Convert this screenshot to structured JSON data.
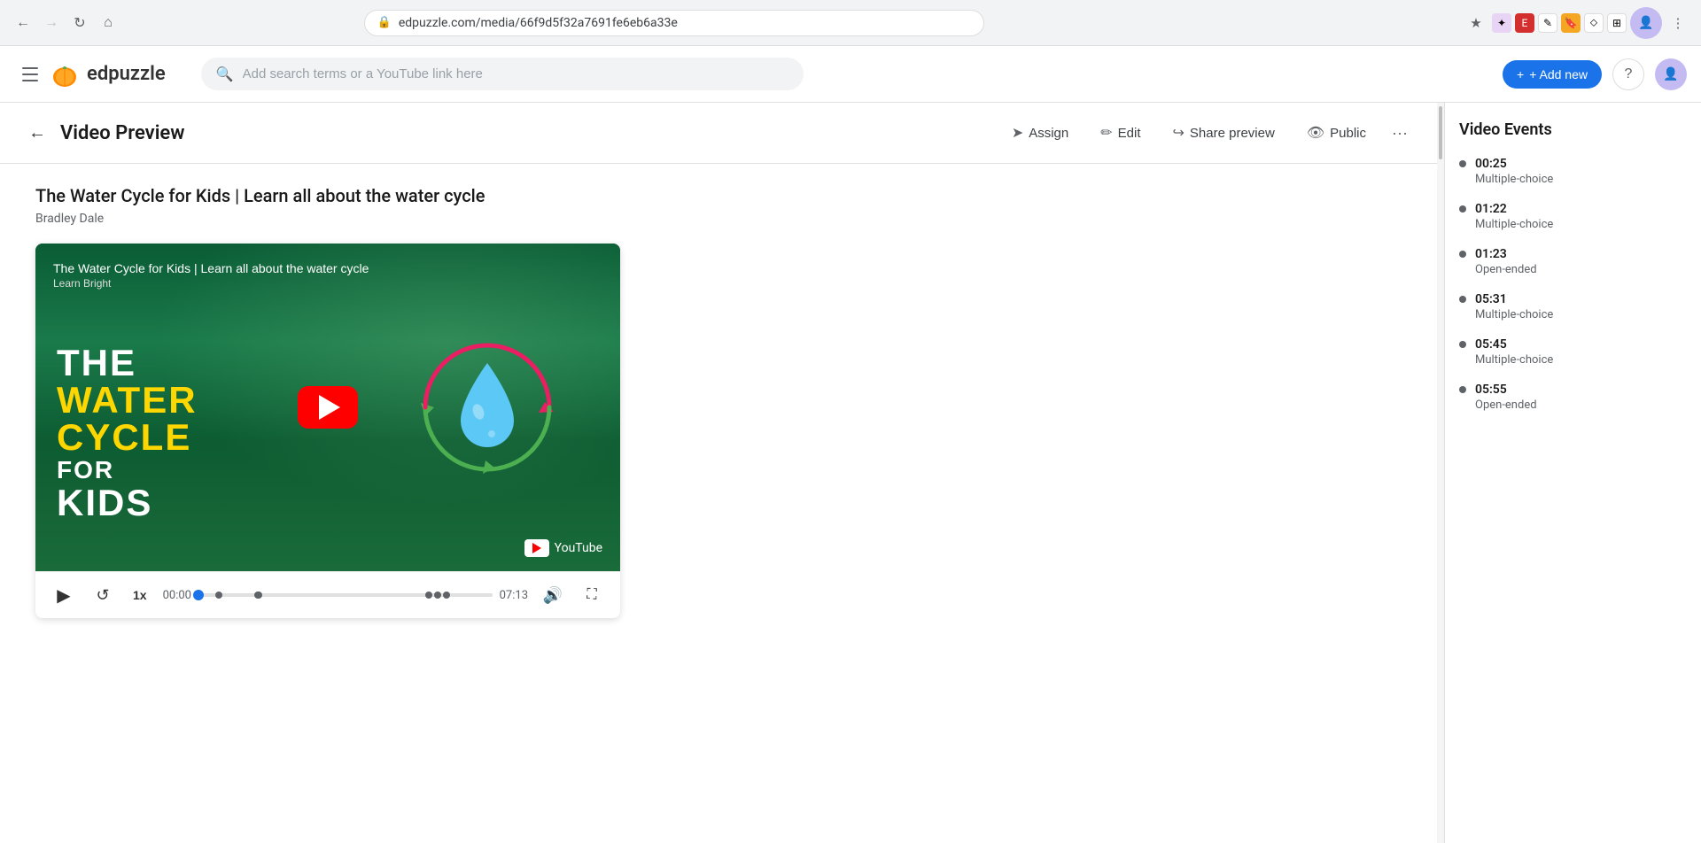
{
  "browser": {
    "url": "edpuzzle.com/media/66f9d5f32a7691fe6eb6a33e",
    "nav": {
      "back_disabled": false,
      "forward_disabled": true,
      "reload_label": "⟳",
      "home_label": "⌂"
    }
  },
  "app": {
    "logo_text": "edpuzzle",
    "search_placeholder": "Add search terms or a YouTube link here",
    "add_new_label": "+ Add new",
    "help_label": "?"
  },
  "toolbar": {
    "back_label": "←",
    "page_title": "Video Preview",
    "assign_label": "Assign",
    "edit_label": "Edit",
    "share_preview_label": "Share preview",
    "public_label": "Public",
    "more_label": "···"
  },
  "video": {
    "title": "The Water Cycle for Kids | Learn all about the water cycle",
    "author": "Bradley Dale",
    "thumbnail_line1": "The Water Cycle for Kids | Learn all about the water cycle",
    "thumbnail_channel": "Learn Bright",
    "text_the": "THE",
    "text_water": "WATER",
    "text_cycle": "CYCLE",
    "text_for": "FOR",
    "text_kids": "KIDS",
    "youtube_label": "YouTube",
    "current_time": "00:00",
    "duration": "07:13",
    "speed": "1x"
  },
  "sidebar": {
    "title": "Video Events",
    "events": [
      {
        "time": "00:25",
        "type": "Multiple-choice"
      },
      {
        "time": "01:22",
        "type": "Multiple-choice"
      },
      {
        "time": "01:23",
        "type": "Open-ended"
      },
      {
        "time": "05:31",
        "type": "Multiple-choice"
      },
      {
        "time": "05:45",
        "type": "Multiple-choice"
      },
      {
        "time": "05:55",
        "type": "Open-ended"
      }
    ]
  }
}
